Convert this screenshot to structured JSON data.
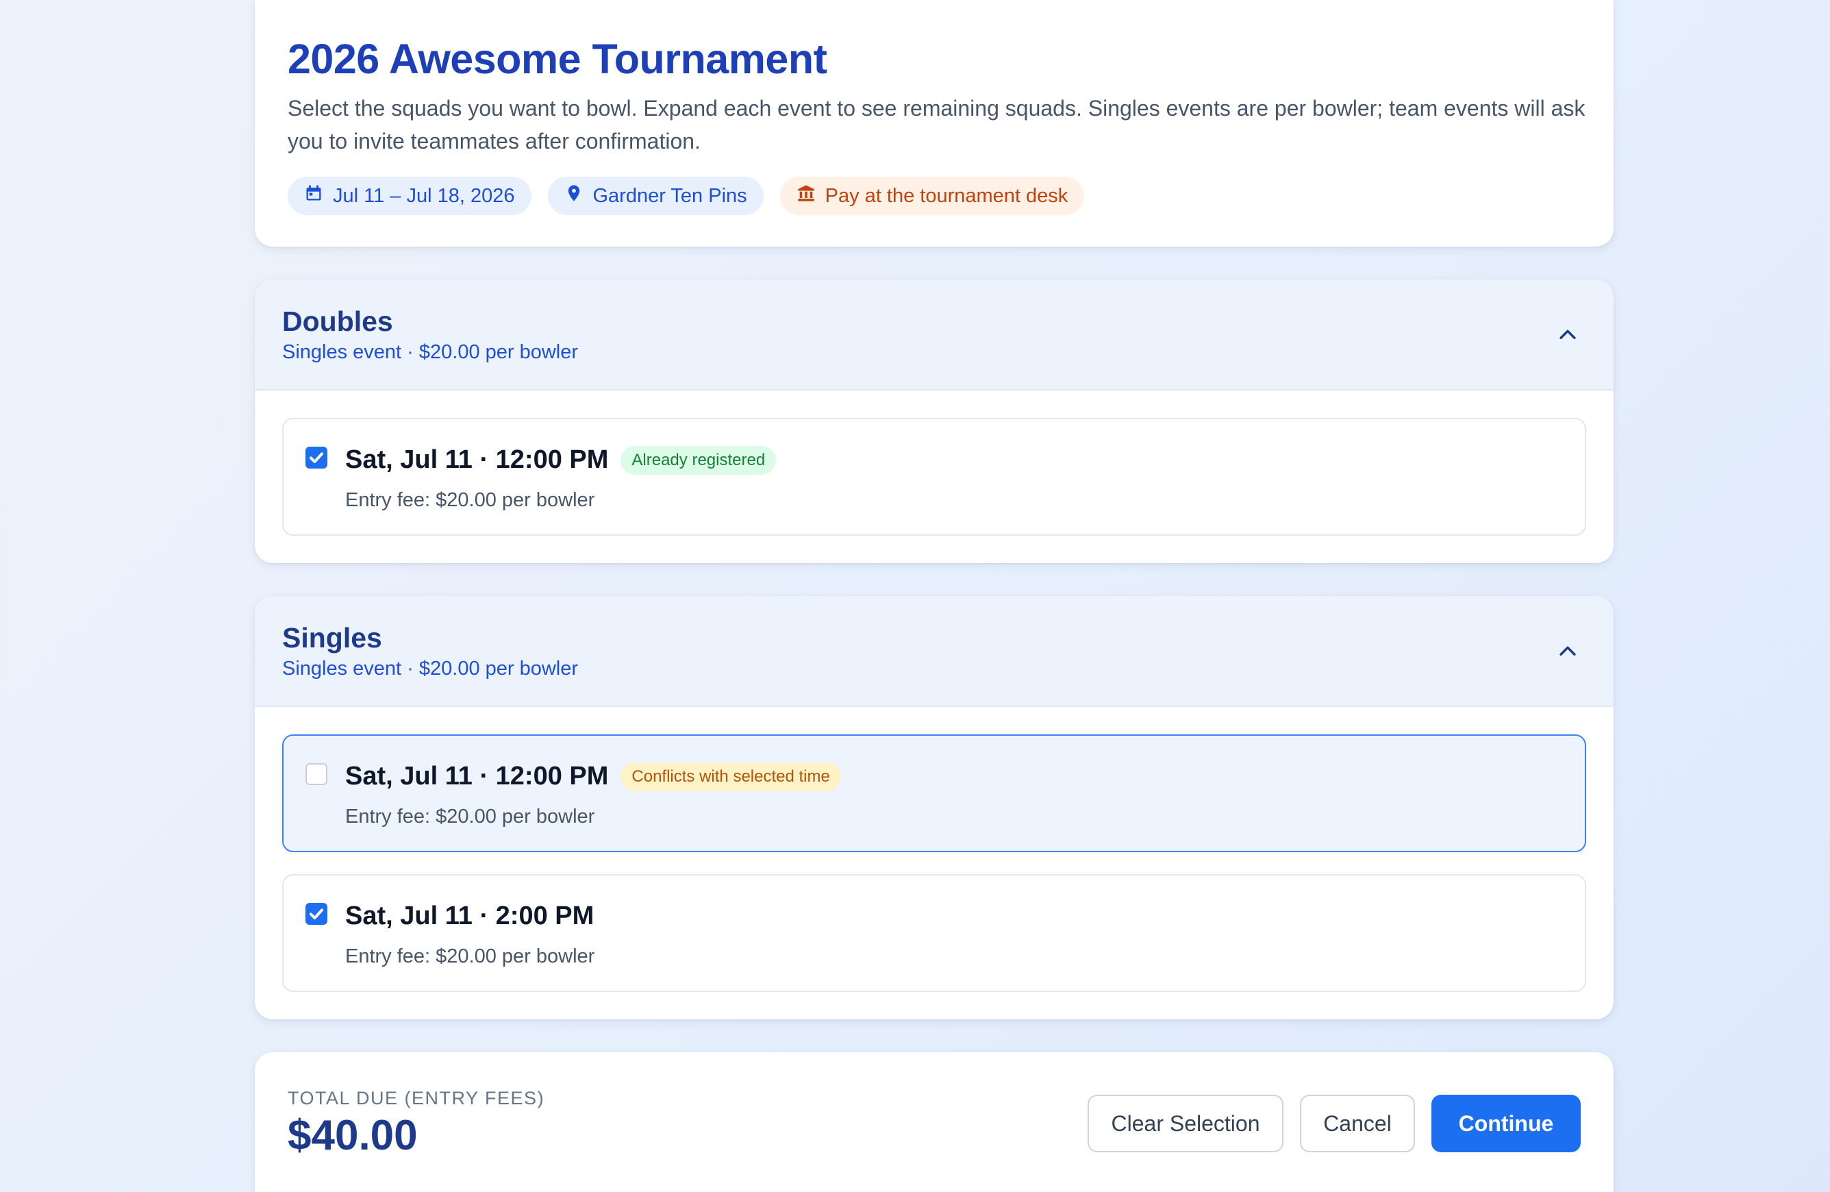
{
  "tournament": {
    "title": "2026 Awesome Tournament",
    "description": "Select the squads you want to bowl. Expand each event to see remaining squads. Singles events are per bowler; team events will ask you to invite teammates after confirmation.",
    "chips": {
      "dates": "Jul 11 – Jul 18, 2026",
      "location": "Gardner Ten Pins",
      "payment": "Pay at the tournament desk"
    }
  },
  "events": [
    {
      "title": "Doubles",
      "subtitle": "Singles event · $20.00 per bowler",
      "expanded": true,
      "squads": [
        {
          "time": "Sat, Jul 11 · 12:00 PM",
          "badge": "Already registered",
          "fee": "Entry fee: $20.00 per bowler",
          "checked": true
        }
      ]
    },
    {
      "title": "Singles",
      "subtitle": "Singles event · $20.00 per bowler",
      "expanded": true,
      "squads": [
        {
          "time": "Sat, Jul 11 · 12:00 PM",
          "badge": "Conflicts with selected time",
          "fee": "Entry fee: $20.00 per bowler",
          "checked": false
        },
        {
          "time": "Sat, Jul 11 · 2:00 PM",
          "fee": "Entry fee: $20.00 per bowler",
          "checked": true
        }
      ]
    }
  ],
  "footer": {
    "total_label": "TOTAL DUE (ENTRY FEES)",
    "total_value": "$40.00",
    "clear_label": "Clear Selection",
    "cancel_label": "Cancel",
    "continue_label": "Continue"
  },
  "icons": {
    "dates": "calendar-icon",
    "location": "map-pin-icon",
    "payment": "bank-icon",
    "collapse": "chevron-up-icon",
    "checkbox": "check-icon"
  },
  "colors": {
    "accent": "#1d6ff2",
    "title": "#1d3fb8",
    "heading": "#1e3a8a",
    "success": "#15803d",
    "warning": "#b45309",
    "payment": "#c2410c"
  }
}
